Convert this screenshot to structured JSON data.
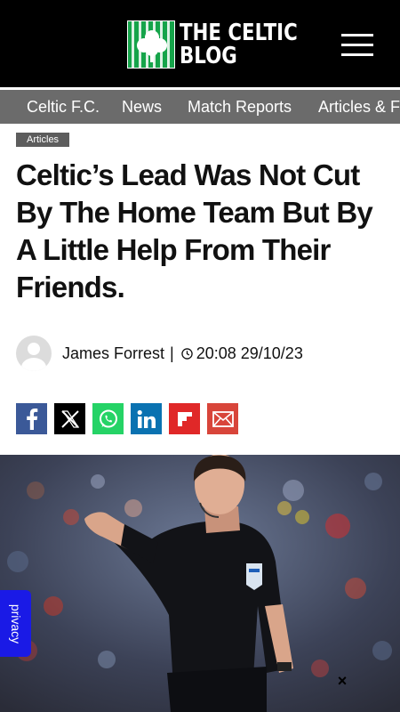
{
  "header": {
    "logo_line1": "THE CELTIC",
    "logo_line2": "BLOG",
    "brand_color": "#15a44a"
  },
  "nav": {
    "items": [
      "Celtic F.C.",
      "News",
      "Match Reports",
      "Articles & F"
    ]
  },
  "article": {
    "category": "Articles",
    "title": "Celtic’s Lead Was Not Cut By The Home Team But By A Little Help From Their Friends.",
    "author": "James Forrest",
    "separator": "|",
    "datetime": "20:08 29/10/23"
  },
  "share": {
    "icons": [
      "facebook-icon",
      "x-icon",
      "whatsapp-icon",
      "linkedin-icon",
      "flipboard-icon",
      "email-icon"
    ]
  },
  "overlay": {
    "privacy_label": "privacy",
    "close_label": "×"
  }
}
